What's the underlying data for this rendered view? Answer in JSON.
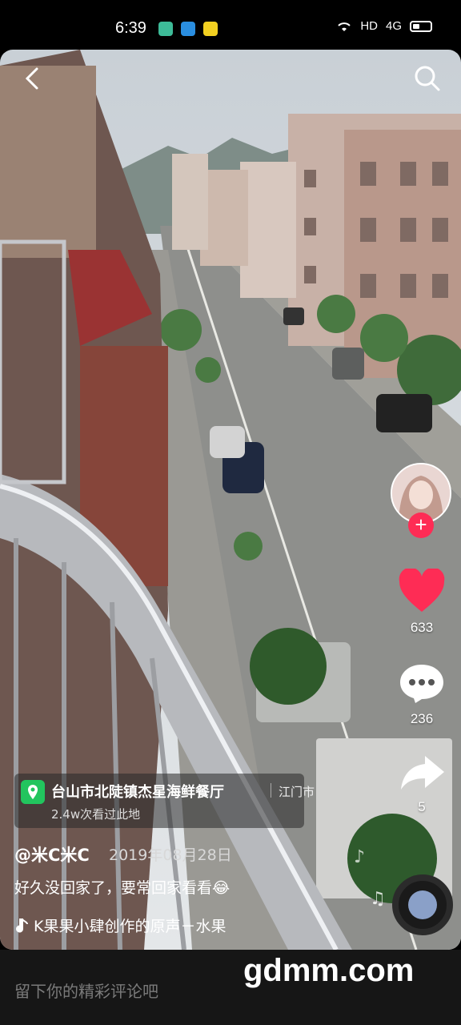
{
  "status_bar": {
    "time": "6:39",
    "network": "HD",
    "signal": "4G"
  },
  "video": {
    "back_icon": "chevron-left-icon",
    "search_icon": "search-icon"
  },
  "actions": {
    "likes": "633",
    "comments": "236",
    "shares": "5",
    "follow_symbol": "+",
    "like_color": "#fe2c55"
  },
  "location": {
    "name": "台山市北陡镇杰星海鲜餐厅",
    "city": "江门市",
    "views": "2.4w次看过此地"
  },
  "post": {
    "author": "@米C米C",
    "date": "2019年08月28日",
    "caption": "好久没回家了，要常回家看看😂",
    "music": "K果果小肆创作的原声－水果"
  },
  "comment_bar": {
    "placeholder": "留下你的精彩评论吧"
  },
  "watermark": "gdmm.com"
}
